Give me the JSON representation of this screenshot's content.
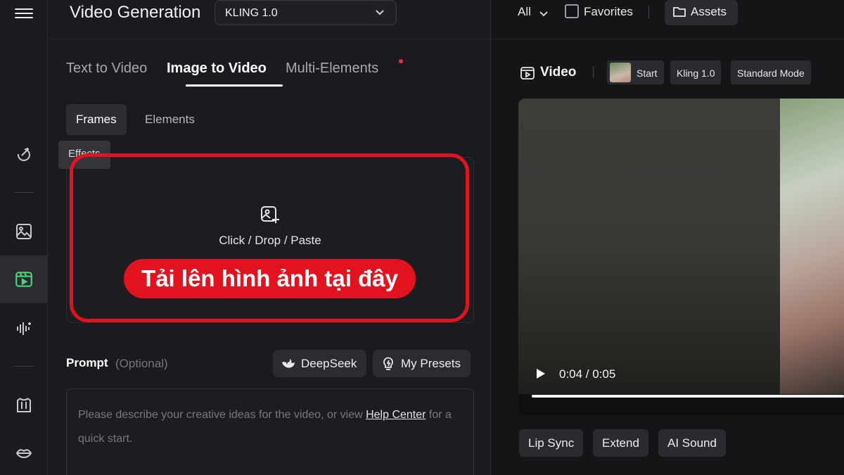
{
  "panel": {
    "title": "Video Generation",
    "model_select": "KLING 1.0",
    "tabs": [
      {
        "label": "Text to Video"
      },
      {
        "label": "Image to Video"
      },
      {
        "label": "Multi-Elements"
      }
    ],
    "subtabs": [
      {
        "label": "Frames"
      },
      {
        "label": "Elements"
      }
    ],
    "tooltip": "Effects",
    "upload": {
      "text": "Click / Drop / Paste",
      "annotation": "Tải lên hình ảnh tại đây"
    },
    "prompt": {
      "label": "Prompt",
      "optional": "(Optional)",
      "deepseek": "DeepSeek",
      "presets": "My Presets",
      "placeholder_before": "Please describe your creative ideas for the video, or view ",
      "help_link": "Help Center",
      "placeholder_after": " for a quick start."
    }
  },
  "right": {
    "filter": "All",
    "favorites": "Favorites",
    "assets": "Assets",
    "video_title": "Video",
    "chips": [
      "Start",
      "Kling 1.0",
      "Standard Mode"
    ],
    "time": "0:04 / 0:05",
    "progress": 0.8,
    "actions": [
      "Lip Sync",
      "Extend",
      "AI Sound"
    ]
  }
}
